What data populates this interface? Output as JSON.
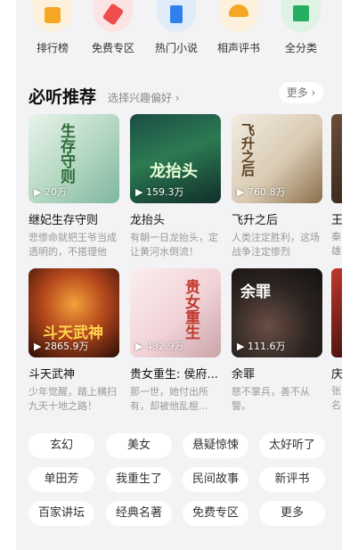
{
  "categories": [
    {
      "label": "排行榜",
      "icon": "ranking-icon",
      "color": "#f5a623"
    },
    {
      "label": "免费专区",
      "icon": "free-tag-icon",
      "color": "#ef4d4d"
    },
    {
      "label": "热门小说",
      "icon": "book-icon",
      "color": "#2f80ed"
    },
    {
      "label": "相声评书",
      "icon": "fan-icon",
      "color": "#f5a623"
    },
    {
      "label": "全分类",
      "icon": "grid-icon",
      "color": "#27ae60"
    }
  ],
  "section": {
    "title": "必听推荐",
    "subtitle": "选择兴趣偏好 ›",
    "more": "更多 ›"
  },
  "books": [
    {
      "title": "继妃生存守则",
      "plays": "▶ 20万",
      "desc": "悲惨命就把王爷当成透明的，不搭理他",
      "art": "生存守则",
      "art_color": "#2e6b3a"
    },
    {
      "title": "龙抬头",
      "plays": "▶ 159.3万",
      "desc": "有朝一日龙抬头，定让黄河水倒流！",
      "art": "龙抬头",
      "art_color": "#e8ffd8"
    },
    {
      "title": "飞升之后",
      "plays": "▶ 760.8万",
      "desc": "人类注定胜利，这场战争注定惨烈",
      "art": "飞升之后",
      "art_color": "#5a4022"
    },
    {
      "title": "斗天武神",
      "plays": "▶ 2865.9万",
      "desc": "少年觉醒，踏上横扫九天十地之路！",
      "art": "斗天武神",
      "art_color": "#ffd34d"
    },
    {
      "title": "贵女重生: 侯府...",
      "plays": "▶ 432.9万",
      "desc": "那一世，她付出所有，却被他乱棍...",
      "art": "贵女重生",
      "art_color": "#c0392b"
    },
    {
      "title": "余罪",
      "plays": "▶ 111.6万",
      "desc": "慈不掌兵，善不从警。",
      "art": "余罪",
      "art_color": "#ffffff"
    }
  ],
  "partial_books": [
    {
      "title": "王",
      "desc": "秦 雄"
    },
    {
      "title": "庆",
      "desc": "张 名"
    }
  ],
  "tags": [
    "玄幻",
    "美女",
    "悬疑惊悚",
    "太好听了",
    "单田芳",
    "我重生了",
    "民间故事",
    "新评书",
    "百家讲坛",
    "经典名著",
    "免费专区",
    "更多"
  ]
}
